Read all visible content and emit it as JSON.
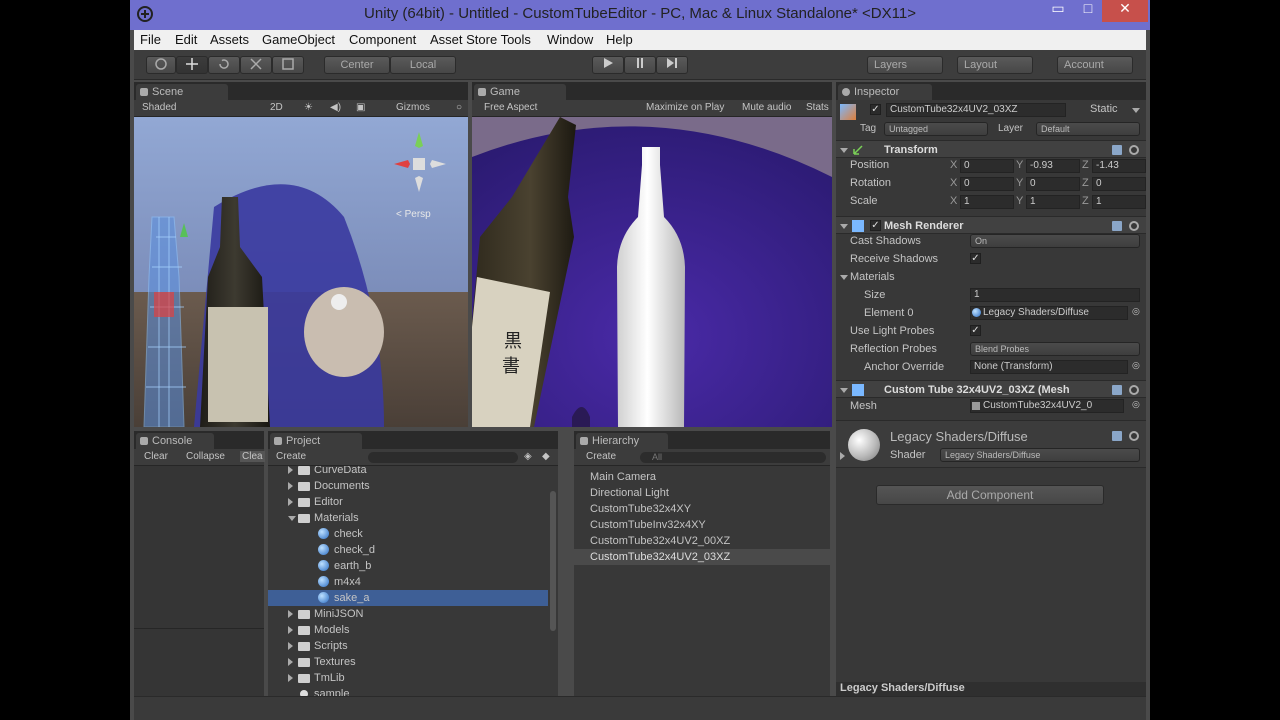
{
  "window": {
    "title": "Unity (64bit) - Untitled - CustomTubeEditor - PC, Mac & Linux Standalone* <DX11>",
    "minimize": "▭",
    "maximize": "□",
    "close": "✕"
  },
  "menu": [
    "File",
    "Edit",
    "Assets",
    "GameObject",
    "Component",
    "Asset Store Tools",
    "Window",
    "Help"
  ],
  "toolbar": {
    "center": "Center",
    "local": "Local",
    "layers": "Layers",
    "layout": "Layout",
    "account": "Account"
  },
  "scene": {
    "tab": "Scene",
    "shading": "Shaded",
    "mode2d": "2D",
    "gizmos": "Gizmos",
    "persp": "< Persp"
  },
  "game": {
    "tab": "Game",
    "aspect": "Free Aspect",
    "maximize": "Maximize on Play",
    "mute": "Mute audio",
    "stats": "Stats"
  },
  "console": {
    "tab": "Console",
    "clear": "Clear",
    "collapse": "Collapse",
    "clear_on_play": "Clea"
  },
  "project": {
    "tab": "Project",
    "create": "Create",
    "items": [
      {
        "label": "CurveData",
        "kind": "folder",
        "depth": 0
      },
      {
        "label": "Documents",
        "kind": "folder",
        "depth": 0
      },
      {
        "label": "Editor",
        "kind": "folder",
        "depth": 0
      },
      {
        "label": "Materials",
        "kind": "folder-open",
        "depth": 0
      },
      {
        "label": "check",
        "kind": "material",
        "depth": 1
      },
      {
        "label": "check_d",
        "kind": "material",
        "depth": 1
      },
      {
        "label": "earth_b",
        "kind": "material",
        "depth": 1
      },
      {
        "label": "m4x4",
        "kind": "material",
        "depth": 1
      },
      {
        "label": "sake_a",
        "kind": "material",
        "depth": 1,
        "selected": true
      },
      {
        "label": "MiniJSON",
        "kind": "folder",
        "depth": 0
      },
      {
        "label": "Models",
        "kind": "folder",
        "depth": 0
      },
      {
        "label": "Scripts",
        "kind": "folder",
        "depth": 0
      },
      {
        "label": "Textures",
        "kind": "folder",
        "depth": 0
      },
      {
        "label": "TmLib",
        "kind": "folder",
        "depth": 0
      },
      {
        "label": "sample",
        "kind": "scene",
        "depth": 0
      }
    ]
  },
  "hierarchy": {
    "tab": "Hierarchy",
    "create": "Create",
    "search_placeholder": "All",
    "items": [
      "Main Camera",
      "Directional Light",
      "CustomTube32x4XY",
      "CustomTubeInv32x4XY",
      "CustomTube32x4UV2_00XZ",
      "CustomTube32x4UV2_03XZ"
    ],
    "selected_index": 5
  },
  "inspector": {
    "tab": "Inspector",
    "object_name": "CustomTube32x4UV2_03XZ",
    "static": "Static",
    "tag_label": "Tag",
    "tag": "Untagged",
    "layer_label": "Layer",
    "layer": "Default",
    "transform": {
      "title": "Transform",
      "rows": [
        {
          "label": "Position",
          "x": "0",
          "y": "-0.93",
          "z": "-1.43"
        },
        {
          "label": "Rotation",
          "x": "0",
          "y": "0",
          "z": "0"
        },
        {
          "label": "Scale",
          "x": "1",
          "y": "1",
          "z": "1"
        }
      ]
    },
    "mesh_renderer": {
      "title": "Mesh Renderer",
      "cast_shadows_label": "Cast Shadows",
      "cast_shadows": "On",
      "receive_shadows_label": "Receive Shadows",
      "materials_label": "Materials",
      "size_label": "Size",
      "size": "1",
      "element0_label": "Element 0",
      "element0": "Legacy Shaders/Diffuse",
      "light_probes_label": "Use Light Probes",
      "reflection_label": "Reflection Probes",
      "reflection": "Blend Probes",
      "anchor_label": "Anchor Override",
      "anchor": "None (Transform)"
    },
    "custom_tube": {
      "title": "Custom Tube 32x4UV2_03XZ (Mesh",
      "mesh_label": "Mesh",
      "mesh": "CustomTube32x4UV2_0"
    },
    "material": {
      "name": "Legacy Shaders/Diffuse",
      "shader_label": "Shader",
      "shader": "Legacy Shaders/Diffuse"
    },
    "add_component": "Add Component",
    "preview_title": "Legacy Shaders/Diffuse"
  },
  "colors": {
    "titlebar": "#6f6fce",
    "selection": "#3e5f96",
    "editor_bg": "#383838"
  }
}
